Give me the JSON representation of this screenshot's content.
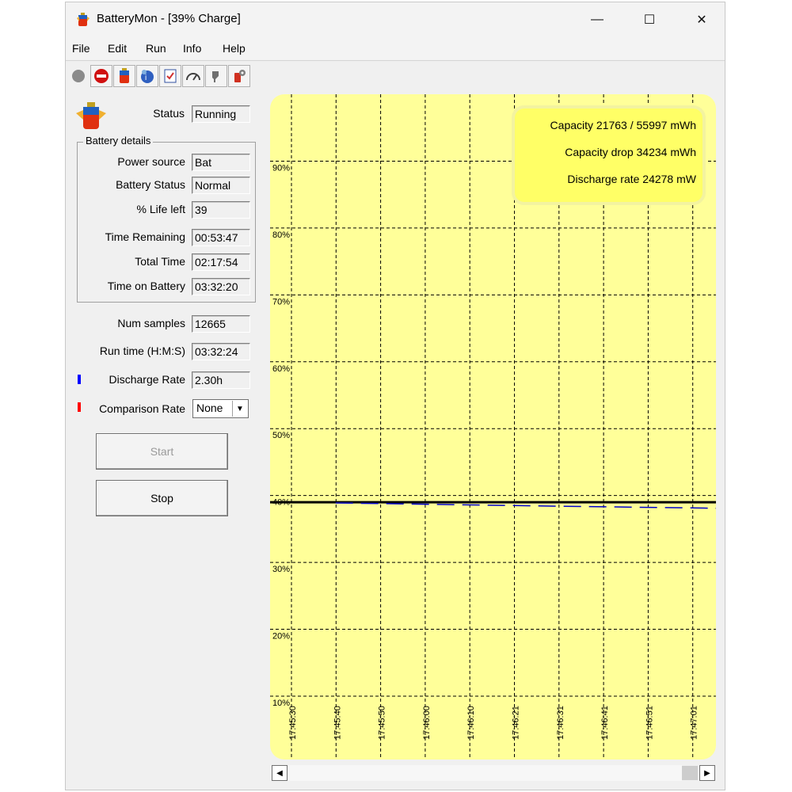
{
  "window": {
    "title": "BatteryMon - [39% Charge]",
    "minimize_glyph": "—",
    "maximize_glyph": "☐",
    "close_glyph": "✕"
  },
  "menu": [
    "File",
    "Edit",
    "Run",
    "Info",
    "Help"
  ],
  "toolbar": {
    "icons": [
      "record-icon",
      "stop-icon",
      "battery-icon",
      "info-icon",
      "checklist-icon",
      "gauge-icon",
      "plug-icon",
      "settings-icon"
    ]
  },
  "status": {
    "label": "Status",
    "value": "Running"
  },
  "battery_details": {
    "title": "Battery details",
    "rows": [
      {
        "label": "Power source",
        "value": "Bat"
      },
      {
        "label": "Battery Status",
        "value": "Normal"
      },
      {
        "label": "% Life left",
        "value": "39"
      },
      {
        "label": "Time Remaining",
        "value": "00:53:47"
      },
      {
        "label": "Total Time",
        "value": "02:17:54"
      },
      {
        "label": "Time on Battery",
        "value": "03:32:20"
      }
    ]
  },
  "samples": {
    "label": "Num samples",
    "value": "12665"
  },
  "runtime": {
    "label": "Run time (H:M:S)",
    "value": "03:32:24"
  },
  "discharge": {
    "label": "Discharge Rate",
    "value": "2.30h",
    "color": "#0000ff"
  },
  "comparison": {
    "label": "Comparison Rate",
    "value": "None",
    "color": "#ff0000"
  },
  "buttons": {
    "start": "Start",
    "stop": "Stop"
  },
  "colors": {
    "chart_bg": "#ffff99",
    "info_box": "#ffff66",
    "actual_line": "#000000",
    "rate_line": "#0000cc"
  },
  "chart_data": {
    "type": "line",
    "info": [
      "Capacity 21763 / 55997 mWh",
      "Capacity drop 34234 mWh",
      "Discharge rate 24278 mW"
    ],
    "y_ticks": [
      "90%",
      "80%",
      "70%",
      "60%",
      "50%",
      "40%",
      "30%",
      "20%",
      "10%"
    ],
    "x_ticks": [
      "17:45:30",
      "17:45:40",
      "17:45:50",
      "17:46:00",
      "17:46:10",
      "17:46:21",
      "17:46:31",
      "17:46:41",
      "17:46:51",
      "17:47:01"
    ],
    "ylim": [
      10,
      100
    ],
    "grid": true,
    "series": [
      {
        "style": "solid",
        "color": "#000000",
        "x": [
          "17:45:30",
          "17:47:07"
        ],
        "y": [
          39,
          39
        ]
      },
      {
        "style": "dashed",
        "color": "#0000cc",
        "x": [
          "17:45:40",
          "17:46:00",
          "17:46:31",
          "17:47:07"
        ],
        "y": [
          38.9,
          38.7,
          38.4,
          38.1
        ]
      }
    ]
  }
}
